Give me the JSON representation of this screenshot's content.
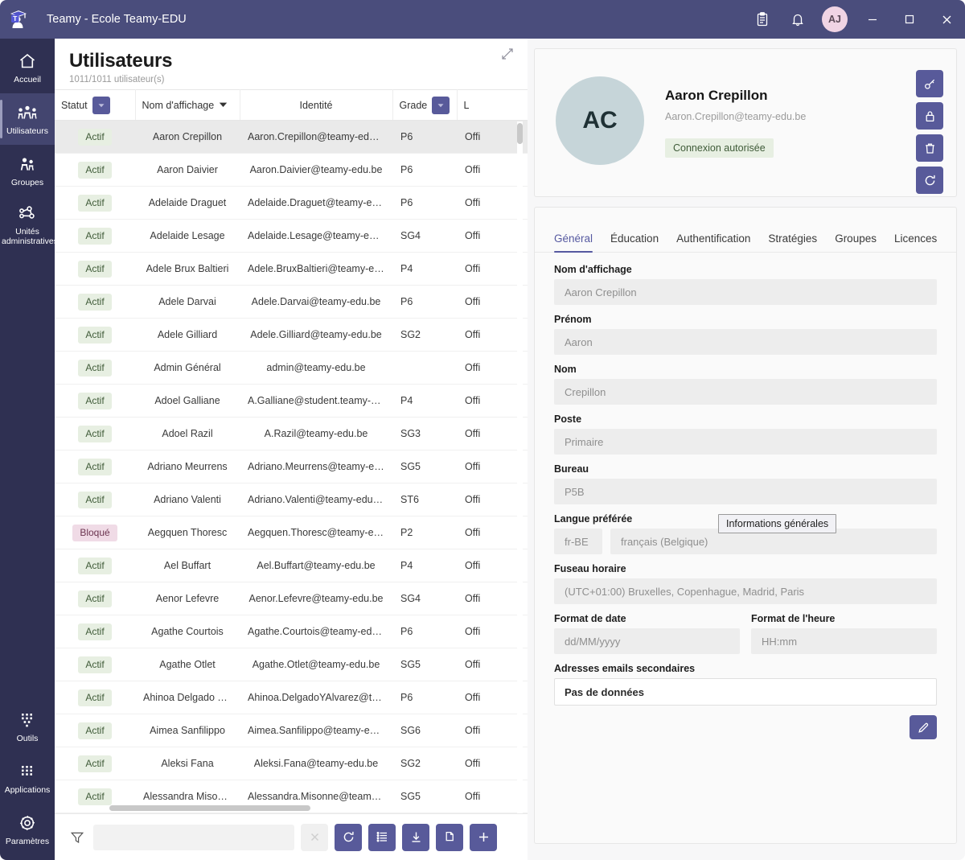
{
  "titlebar": {
    "app_title": "Teamy - Ecole Teamy-EDU",
    "logo_icon": "teamy-graduate-logo",
    "clipboard_icon": "clipboard-icon",
    "bell_icon": "bell-icon",
    "avatar_initials": "AJ",
    "minimize_icon": "minimize-icon",
    "maximize_icon": "maximize-icon",
    "close_icon": "close-icon",
    "bg_color": "#4a4d7c"
  },
  "rail": {
    "bg_color": "#2f3052",
    "active_color": "#43456f",
    "items": [
      {
        "label": "Accueil",
        "icon": "home-icon",
        "active": false
      },
      {
        "label": "Utilisateurs",
        "icon": "users-icon",
        "active": true
      },
      {
        "label": "Groupes",
        "icon": "groups-icon",
        "active": false
      },
      {
        "label": "Unités administratives",
        "icon": "org-units-icon",
        "active": false
      }
    ],
    "bottom_items": [
      {
        "label": "Outils",
        "icon": "grid-tools-icon"
      },
      {
        "label": "Applications",
        "icon": "grid-apps-icon"
      },
      {
        "label": "Paramètres",
        "icon": "gear-icon"
      }
    ]
  },
  "users_panel": {
    "title": "Utilisateurs",
    "subtitle": "1011/1011 utilisateur(s)",
    "expand_icon": "expand-diagonal-icon",
    "columns": [
      {
        "label": "Statut",
        "filter": true,
        "sort": false,
        "align": "center"
      },
      {
        "label": "Nom d'affichage",
        "filter": false,
        "sort": true,
        "align": "center"
      },
      {
        "label": "Identité",
        "filter": false,
        "sort": false,
        "align": "center"
      },
      {
        "label": "Grade",
        "filter": true,
        "sort": false,
        "align": "left"
      },
      {
        "label": "L",
        "filter": false,
        "sort": false,
        "align": "left"
      }
    ],
    "rows": [
      {
        "statut": "Actif",
        "nom": "Aaron Crepillon",
        "identite": "Aaron.Crepillon@teamy-edu.be",
        "grade": "P6",
        "licence": "Offi",
        "selected": true
      },
      {
        "statut": "Actif",
        "nom": "Aaron Daivier",
        "identite": "Aaron.Daivier@teamy-edu.be",
        "grade": "P6",
        "licence": "Offi",
        "selected": false
      },
      {
        "statut": "Actif",
        "nom": "Adelaide Draguet",
        "identite": "Adelaide.Draguet@teamy-edu.be",
        "grade": "P6",
        "licence": "Offi",
        "selected": false
      },
      {
        "statut": "Actif",
        "nom": "Adelaide Lesage",
        "identite": "Adelaide.Lesage@teamy-edu.be",
        "grade": "SG4",
        "licence": "Offi",
        "selected": false
      },
      {
        "statut": "Actif",
        "nom": "Adele Brux Baltieri",
        "identite": "Adele.BruxBaltieri@teamy-edu.be",
        "grade": "P4",
        "licence": "Offi",
        "selected": false
      },
      {
        "statut": "Actif",
        "nom": "Adele Darvai",
        "identite": "Adele.Darvai@teamy-edu.be",
        "grade": "P6",
        "licence": "Offi",
        "selected": false
      },
      {
        "statut": "Actif",
        "nom": "Adele Gilliard",
        "identite": "Adele.Gilliard@teamy-edu.be",
        "grade": "SG2",
        "licence": "Offi",
        "selected": false
      },
      {
        "statut": "Actif",
        "nom": "Admin Général",
        "identite": "admin@teamy-edu.be",
        "grade": "",
        "licence": "Offi",
        "selected": false
      },
      {
        "statut": "Actif",
        "nom": "Adoel Galliane",
        "identite": "A.Galliane@student.teamy-edu.be",
        "grade": "P4",
        "licence": "Offi",
        "selected": false
      },
      {
        "statut": "Actif",
        "nom": "Adoel Razil",
        "identite": "A.Razil@teamy-edu.be",
        "grade": "SG3",
        "licence": "Offi",
        "selected": false
      },
      {
        "statut": "Actif",
        "nom": "Adriano Meurrens",
        "identite": "Adriano.Meurrens@teamy-edu.be",
        "grade": "SG5",
        "licence": "Offi",
        "selected": false
      },
      {
        "statut": "Actif",
        "nom": "Adriano Valenti",
        "identite": "Adriano.Valenti@teamy-edu.be",
        "grade": "ST6",
        "licence": "Offi",
        "selected": false
      },
      {
        "statut": "Bloqué",
        "nom": "Aegquen Thoresc",
        "identite": "Aegquen.Thoresc@teamy-edu.be",
        "grade": "P2",
        "licence": "Offi",
        "selected": false
      },
      {
        "statut": "Actif",
        "nom": "Ael Buffart",
        "identite": "Ael.Buffart@teamy-edu.be",
        "grade": "P4",
        "licence": "Offi",
        "selected": false
      },
      {
        "statut": "Actif",
        "nom": "Aenor Lefevre",
        "identite": "Aenor.Lefevre@teamy-edu.be",
        "grade": "SG4",
        "licence": "Offi",
        "selected": false
      },
      {
        "statut": "Actif",
        "nom": "Agathe Courtois",
        "identite": "Agathe.Courtois@teamy-edu.be",
        "grade": "P6",
        "licence": "Offi",
        "selected": false
      },
      {
        "statut": "Actif",
        "nom": "Agathe Otlet",
        "identite": "Agathe.Otlet@teamy-edu.be",
        "grade": "SG5",
        "licence": "Offi",
        "selected": false
      },
      {
        "statut": "Actif",
        "nom": "Ahinoa Delgado Y Al…",
        "identite": "Ahinoa.DelgadoYAlvarez@team…",
        "grade": "P6",
        "licence": "Offi",
        "selected": false
      },
      {
        "statut": "Actif",
        "nom": "Aimea Sanfilippo",
        "identite": "Aimea.Sanfilippo@teamy-edu.be",
        "grade": "SG6",
        "licence": "Offi",
        "selected": false
      },
      {
        "statut": "Actif",
        "nom": "Aleksi Fana",
        "identite": "Aleksi.Fana@teamy-edu.be",
        "grade": "SG2",
        "licence": "Offi",
        "selected": false
      },
      {
        "statut": "Actif",
        "nom": "Alessandra Misonne",
        "identite": "Alessandra.Misonne@teamy-ed…",
        "grade": "SG5",
        "licence": "Offi",
        "selected": false
      }
    ],
    "toolbar": {
      "funnel_icon": "funnel-filter-icon",
      "filter_value": "",
      "filter_placeholder": "",
      "clear_icon": "close-x-icon",
      "refresh_icon": "refresh-icon",
      "columns_icon": "list-columns-icon",
      "download_icon": "download-icon",
      "copy_icon": "copy-icon",
      "add_icon": "plus-icon"
    }
  },
  "detail": {
    "avatar_initials": "AC",
    "name": "Aaron Crepillon",
    "email": "Aaron.Crepillon@teamy-edu.be",
    "status_badge": "Connexion autorisée",
    "actions": [
      {
        "icon": "key-icon"
      },
      {
        "icon": "lock-icon"
      },
      {
        "icon": "trash-icon"
      },
      {
        "icon": "refresh-icon"
      }
    ],
    "tabs": [
      {
        "label": "Général",
        "active": true
      },
      {
        "label": "Éducation",
        "active": false
      },
      {
        "label": "Authentification",
        "active": false
      },
      {
        "label": "Stratégies",
        "active": false
      },
      {
        "label": "Groupes",
        "active": false
      },
      {
        "label": "Licences",
        "active": false
      }
    ],
    "tooltip": "Informations générales",
    "edit_icon": "pencil-edit-icon",
    "fields": {
      "display_name_label": "Nom d'affichage",
      "display_name_value": "Aaron Crepillon",
      "firstname_label": "Prénom",
      "firstname_value": "Aaron",
      "lastname_label": "Nom",
      "lastname_value": "Crepillon",
      "job_label": "Poste",
      "job_value": "Primaire",
      "office_label": "Bureau",
      "office_value": "P5B",
      "language_label": "Langue préférée",
      "language_code": "fr-BE",
      "language_name": "français (Belgique)",
      "timezone_label": "Fuseau horaire",
      "timezone_value": "(UTC+01:00) Bruxelles, Copenhague, Madrid, Paris",
      "dateformat_label": "Format de date",
      "dateformat_value": "dd/MM/yyyy",
      "timeformat_label": "Format de l'heure",
      "timeformat_value": "HH:mm",
      "secondary_emails_label": "Adresses emails secondaires",
      "secondary_emails_value": "Pas de données"
    }
  },
  "colors": {
    "accent": "#585a9a",
    "titlebar": "#4a4d7c",
    "rail": "#2f3052",
    "badge_green_bg": "#e7efe2",
    "badge_pink_bg": "#f0dbe6"
  }
}
